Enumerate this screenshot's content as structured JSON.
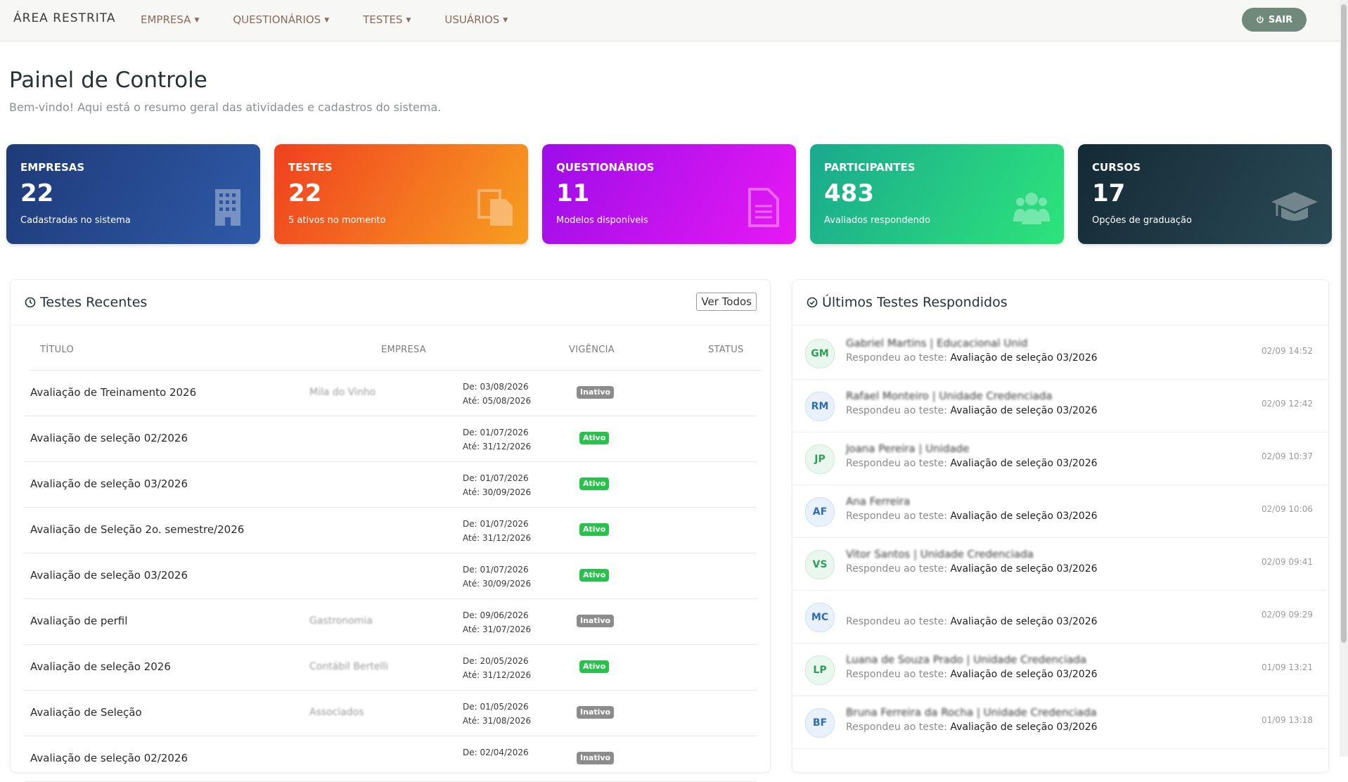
{
  "navbar": {
    "brand": "ÁREA RESTRITA",
    "menu": [
      {
        "label": "EMPRESA"
      },
      {
        "label": "QUESTIONÁRIOS"
      },
      {
        "label": "TESTES"
      },
      {
        "label": "USUÁRIOS"
      }
    ],
    "logout_label": "SAIR"
  },
  "header": {
    "title": "Painel de Controle",
    "subtitle": "Bem-vindo! Aqui está o resumo geral das atividades e cadastros do sistema."
  },
  "stats": [
    {
      "label": "EMPRESAS",
      "value": "22",
      "desc": "Cadastradas no sistema",
      "icon": "building-icon"
    },
    {
      "label": "TESTES",
      "value": "22",
      "desc": "5 ativos no momento",
      "icon": "copy-icon"
    },
    {
      "label": "QUESTIONÁRIOS",
      "value": "11",
      "desc": "Modelos disponíveis",
      "icon": "file-text-icon"
    },
    {
      "label": "PARTICIPANTES",
      "value": "483",
      "desc": "Avaliados respondendo",
      "icon": "users-icon"
    },
    {
      "label": "CURSOS",
      "value": "17",
      "desc": "Opções de graduação",
      "icon": "graduation-cap-icon"
    }
  ],
  "recent_tests": {
    "title": "Testes Recentes",
    "view_all_label": "Ver Todos",
    "columns": [
      "TÍTULO",
      "EMPRESA",
      "VIGÊNCIA",
      "STATUS"
    ],
    "rows": [
      {
        "title": "Avaliação de Treinamento 2026",
        "company": "Mila do Vinho",
        "from": "De: 03/08/2026",
        "to": "Até: 05/08/2026",
        "status": "Inativo"
      },
      {
        "title": "Avaliação de seleção 02/2026",
        "company": "",
        "from": "De: 01/07/2026",
        "to": "Até: 31/12/2026",
        "status": "Ativo"
      },
      {
        "title": "Avaliação de seleção 03/2026",
        "company": "",
        "from": "De: 01/07/2026",
        "to": "Até: 30/09/2026",
        "status": "Ativo"
      },
      {
        "title": "Avaliação de Seleção 2o. semestre/2026",
        "company": "",
        "from": "De: 01/07/2026",
        "to": "Até: 31/12/2026",
        "status": "Ativo"
      },
      {
        "title": "Avaliação de seleção 03/2026",
        "company": "",
        "from": "De: 01/07/2026",
        "to": "Até: 30/09/2026",
        "status": "Ativo"
      },
      {
        "title": "Avaliação de perfil",
        "company": "Gastronomia",
        "from": "De: 09/06/2026",
        "to": "Até: 31/07/2026",
        "status": "Inativo"
      },
      {
        "title": "Avaliação de seleção 2026",
        "company": "Contábil Bertelli",
        "from": "De: 20/05/2026",
        "to": "Até: 31/12/2026",
        "status": "Ativo"
      },
      {
        "title": "Avaliação de Seleção",
        "company": "Associados",
        "from": "De: 01/05/2026",
        "to": "Até: 31/08/2026",
        "status": "Inativo"
      },
      {
        "title": "Avaliação de seleção 02/2026",
        "company": "",
        "from": "De: 02/04/2026",
        "to": "",
        "status": "Inativo"
      }
    ]
  },
  "answered": {
    "title": "Últimos Testes Respondidos",
    "prefix": "Respondeu ao teste:",
    "items": [
      {
        "initials": "GM",
        "name": "Gabriel Martins | Educacional Unid",
        "test": "Avaliação de seleção 03/2026",
        "time": "02/09 14:52"
      },
      {
        "initials": "RM",
        "name": "Rafael Monteiro | Unidade Credenciada",
        "test": "Avaliação de seleção 03/2026",
        "time": "02/09 12:42"
      },
      {
        "initials": "JP",
        "name": "Joana Pereira | Unidade",
        "test": "Avaliação de seleção 03/2026",
        "time": "02/09 10:37"
      },
      {
        "initials": "AF",
        "name": "Ana Ferreira",
        "test": "Avaliação de seleção 03/2026",
        "time": "02/09 10:06"
      },
      {
        "initials": "VS",
        "name": "Vitor Santos | Unidade Credenciada",
        "test": "Avaliação de seleção 03/2026",
        "time": "02/09 09:41"
      },
      {
        "initials": "MC",
        "name": "",
        "test": "Avaliação de seleção 03/2026",
        "time": "02/09 09:29"
      },
      {
        "initials": "LP",
        "name": "Luana de Souza Prado | Unidade Credenciada",
        "test": "Avaliação de seleção 03/2026",
        "time": "01/09 13:21"
      },
      {
        "initials": "BF",
        "name": "Bruna Ferreira da Rocha | Unidade Credenciada",
        "test": "Avaliação de seleção 03/2026",
        "time": "01/09 13:18"
      }
    ]
  },
  "colors": {
    "navbar_bg": "#f7f7f5",
    "nav_link": "#8a6b5e",
    "logout_bg": "#6f8a7a",
    "badge_active": "#27c24c",
    "badge_inactive": "#8c8c8c"
  }
}
